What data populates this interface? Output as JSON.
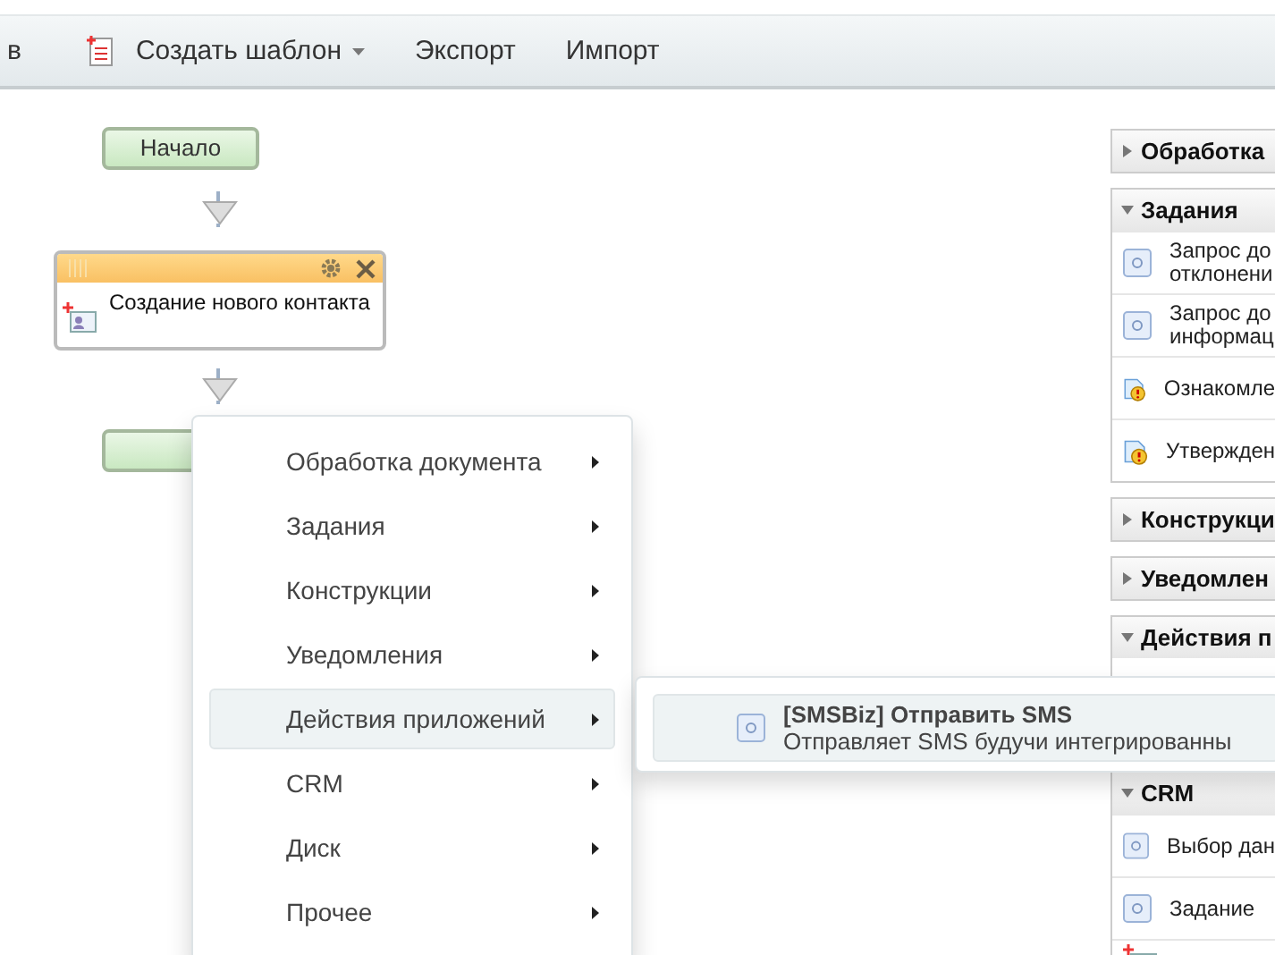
{
  "toolbar": {
    "items": [
      {
        "kind": "plain",
        "label": "в"
      },
      {
        "kind": "dropdown",
        "label": "Создать шаблон"
      },
      {
        "kind": "plain",
        "label": "Экспорт"
      },
      {
        "kind": "plain",
        "label": "Импорт"
      }
    ]
  },
  "diagram": {
    "nodes": [
      {
        "kind": "terminal",
        "label": "Начало"
      },
      {
        "kind": "activity",
        "label": "Создание нового контакта"
      },
      {
        "kind": "terminal"
      }
    ]
  },
  "menu": {
    "items": [
      {
        "label": "Обработка документа",
        "selected": false
      },
      {
        "label": "Задания",
        "selected": false
      },
      {
        "label": "Конструкции",
        "selected": false
      },
      {
        "label": "Уведомления",
        "selected": false
      },
      {
        "label": "Действия приложений",
        "selected": true
      },
      {
        "label": "CRM",
        "selected": false
      },
      {
        "label": "Диск",
        "selected": false
      },
      {
        "label": "Прочее",
        "selected": false
      }
    ]
  },
  "submenu": {
    "items": [
      {
        "title": "[SMSBiz] Отправить SMS",
        "description": "Отправляет SMS будучи интегрированны"
      }
    ]
  },
  "sidebar": {
    "sections": [
      {
        "title": "Обработка",
        "expanded": false
      },
      {
        "title": "Задания",
        "expanded": true,
        "items": [
          {
            "kind": "form",
            "label": "Запрос до\nотклонени"
          },
          {
            "kind": "form",
            "label": "Запрос до\nинформац"
          },
          {
            "kind": "warning",
            "label": "Ознакомле"
          },
          {
            "kind": "warning",
            "label": "Утвержден"
          }
        ]
      },
      {
        "title": "Конструкци",
        "expanded": false
      },
      {
        "title": "Уведомлен",
        "expanded": false
      },
      {
        "title": "Действия п",
        "expanded": true
      },
      {
        "title": "CRM",
        "expanded": true,
        "items": [
          {
            "kind": "form",
            "label": "Выбор дан"
          },
          {
            "kind": "form",
            "label": "Задание"
          },
          {
            "kind": "create"
          }
        ]
      }
    ]
  }
}
